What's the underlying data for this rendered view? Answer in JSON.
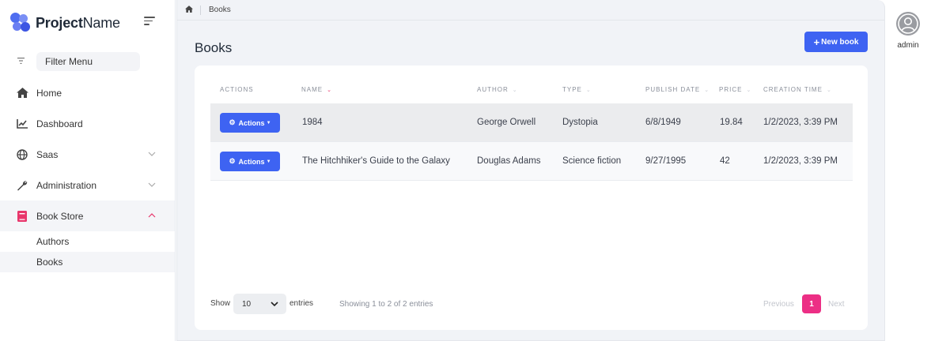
{
  "brand": {
    "bold": "Project",
    "regular": "Name"
  },
  "sidebar": {
    "filter_placeholder": "Filter Menu",
    "items": [
      {
        "label": "Home",
        "icon": "home-icon"
      },
      {
        "label": "Dashboard",
        "icon": "chart-line-icon"
      },
      {
        "label": "Saas",
        "icon": "globe-icon",
        "expandable": true
      },
      {
        "label": "Administration",
        "icon": "wrench-icon",
        "expandable": true
      },
      {
        "label": "Book Store",
        "icon": "book-icon",
        "expandable": true,
        "expanded": true
      }
    ],
    "sub_items": [
      {
        "label": "Authors"
      },
      {
        "label": "Books",
        "active": true
      }
    ]
  },
  "breadcrumb": {
    "home_icon": "home-icon",
    "current": "Books"
  },
  "page": {
    "title": "Books",
    "new_button": "New book"
  },
  "table": {
    "headers": [
      "ACTIONS",
      "NAME",
      "AUTHOR",
      "TYPE",
      "PUBLISH DATE",
      "PRICE",
      "CREATION TIME"
    ],
    "sorted_column": "NAME",
    "actions_label": "Actions",
    "rows": [
      {
        "name": "1984",
        "author": "George Orwell",
        "type": "Dystopia",
        "publish_date": "6/8/1949",
        "price": "19.84",
        "creation_time": "1/2/2023, 3:39 PM"
      },
      {
        "name": "The Hitchhiker's Guide to the Galaxy",
        "author": "Douglas Adams",
        "type": "Science fiction",
        "publish_date": "9/27/1995",
        "price": "42",
        "creation_time": "1/2/2023, 3:39 PM"
      }
    ]
  },
  "footer": {
    "show_label": "Show",
    "page_size": "10",
    "entries_label": "entries",
    "showing_text": "Showing 1 to 2 of 2 entries",
    "previous": "Previous",
    "current_page": "1",
    "next": "Next"
  },
  "user": {
    "name": "admin"
  },
  "colors": {
    "primary": "#3e63f2",
    "accent": "#ec2f85",
    "active_icon": "#e8366b"
  }
}
